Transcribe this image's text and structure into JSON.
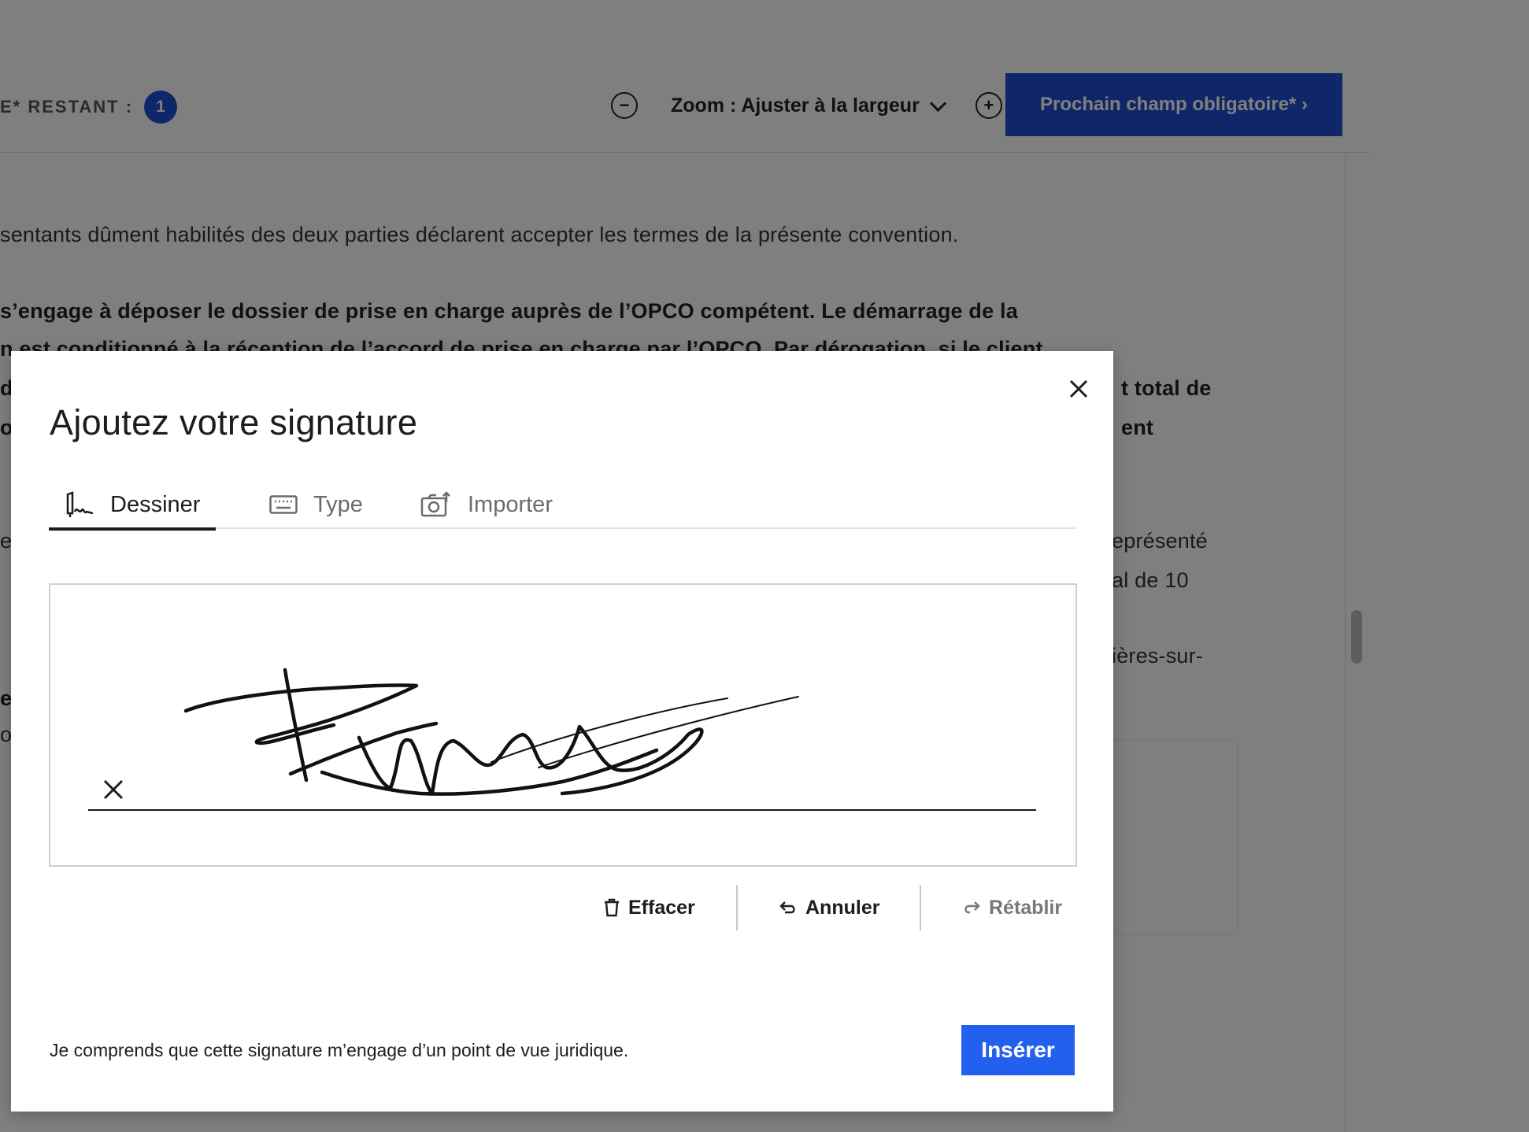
{
  "toolbar": {
    "remaining_label": "E* RESTANT :",
    "remaining_count": "1",
    "zoom_out": "−",
    "zoom_label": "Zoom : Ajuster à la largeur",
    "zoom_in": "+",
    "next_field_label": "Prochain champ obligatoire* ›"
  },
  "document": {
    "lines": [
      "sentants dûment habilités des deux parties déclarent accepter les termes de la présente convention.",
      "s’engage à déposer le dossier de prise en charge auprès de l’OPCO compétent. Le démarrage de la",
      "n est conditionné à la réception de l’accord de prise en charge par l’OPCO. Par dérogation, si le client",
      "d",
      "t total de",
      "o",
      "ent",
      "e",
      "eprésenté",
      "al de 10",
      "ières-sur-",
      "e",
      "o"
    ]
  },
  "modal": {
    "title": "Ajoutez votre signature",
    "tabs": [
      {
        "label": "Dessiner",
        "icon": "draw-signature-icon",
        "active": true
      },
      {
        "label": "Type",
        "icon": "keyboard-icon",
        "active": false
      },
      {
        "label": "Importer",
        "icon": "camera-upload-icon",
        "active": false
      }
    ],
    "actions": {
      "clear": "Effacer",
      "undo": "Annuler",
      "redo": "Rétablir"
    },
    "legal_text": "Je comprends que cette signature m’engage d’un point de vue juridique.",
    "insert_label": "Insérer"
  },
  "colors": {
    "primary": "#1f4fd1",
    "insert": "#2360f0",
    "overlay": "rgba(0,0,0,0.5)"
  }
}
